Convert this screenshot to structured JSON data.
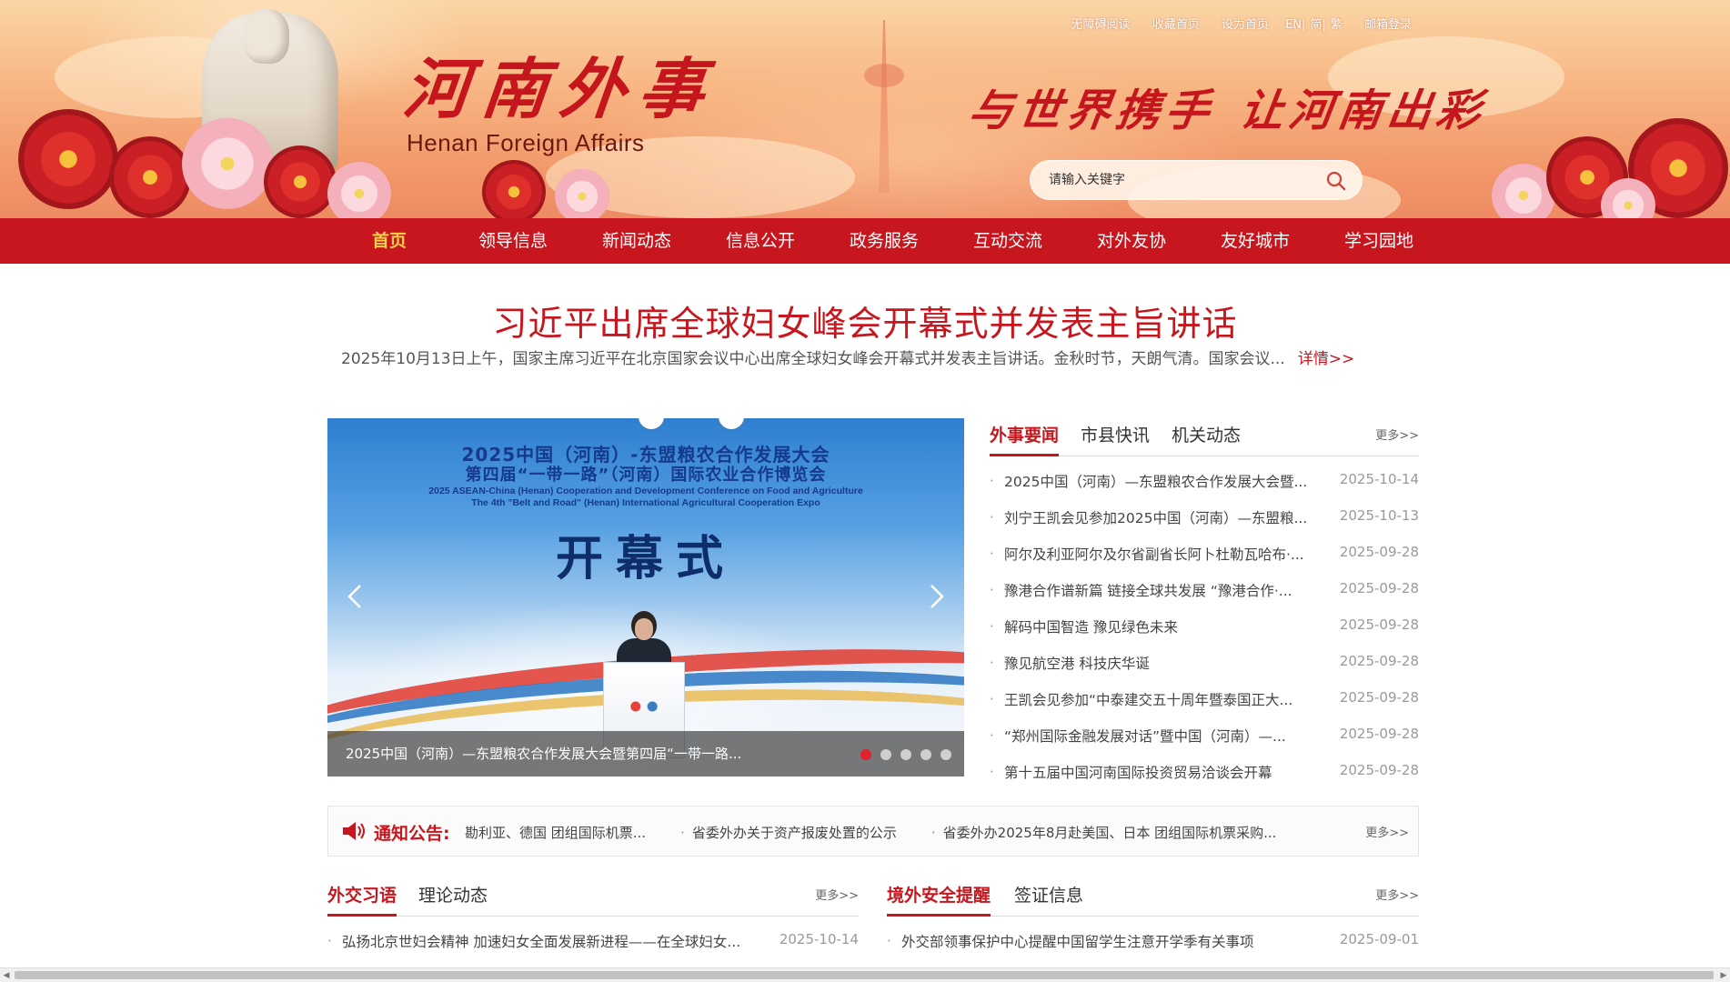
{
  "header": {
    "logo_cn": "河南外事",
    "logo_en": "Henan  Foreign Affairs",
    "slogan_a": "与世界携手",
    "slogan_b": "让河南出彩",
    "toplinks": {
      "accessible": "无障碍阅读",
      "favorite": "收藏首页",
      "set_home": "设为首页",
      "lang_en": "EN",
      "lang_simplified": "简",
      "lang_traditional": "繁",
      "mail_login": "邮箱登录",
      "sep": "|"
    },
    "search": {
      "placeholder": "请输入关键字",
      "icon": "search-icon"
    }
  },
  "nav": {
    "items": [
      {
        "label": "首页",
        "active": true
      },
      {
        "label": "领导信息"
      },
      {
        "label": "新闻动态"
      },
      {
        "label": "信息公开"
      },
      {
        "label": "政务服务"
      },
      {
        "label": "互动交流"
      },
      {
        "label": "对外友协"
      },
      {
        "label": "友好城市"
      },
      {
        "label": "学习园地"
      }
    ]
  },
  "headline": {
    "title": "习近平出席全球妇女峰会开幕式并发表主旨讲话",
    "summary": "2025年10月13日上午，国家主席习近平在北京国家会议中心出席全球妇女峰会开幕式并发表主旨讲话。金秋时节，天朗气清。国家会议...",
    "more": "详情>>"
  },
  "carousel": {
    "slide_title_1": "2025中国（河南）-东盟粮农合作发展大会",
    "slide_title_2": "第四届“一带一路”（河南）国际农业合作博览会",
    "slide_en_1": "2025 ASEAN-China (Henan) Cooperation and Development Conference on Food and Agriculture",
    "slide_en_2": "The 4th \"Belt and Road\" (Henan) International Agricultural Cooperation Expo",
    "slide_big": "开幕式",
    "caption": "2025中国（河南）—东盟粮农合作发展大会暨第四届“一带一路...",
    "dots": 5,
    "active_dot": 1
  },
  "news": {
    "tabs": [
      "外事要闻",
      "市县快讯",
      "机关动态"
    ],
    "more": "更多>>",
    "items": [
      {
        "title": "2025中国（河南）—东盟粮农合作发展大会暨...",
        "date": "2025-10-14"
      },
      {
        "title": "刘宁王凯会见参加2025中国（河南）—东盟粮...",
        "date": "2025-10-13"
      },
      {
        "title": "阿尔及利亚阿尔及尔省副省长阿卜杜勒瓦哈布·...",
        "date": "2025-09-28"
      },
      {
        "title": "豫港合作谱新篇 链接全球共发展 “豫港合作·...",
        "date": "2025-09-28"
      },
      {
        "title": "解码中国智造 豫见绿色未来",
        "date": "2025-09-28"
      },
      {
        "title": "豫见航空港 科技庆华诞",
        "date": "2025-09-28"
      },
      {
        "title": "王凯会见参加“中泰建交五十周年暨泰国正大...",
        "date": "2025-09-28"
      },
      {
        "title": "“郑州国际金融发展对话”暨中国（河南）—...",
        "date": "2025-09-28"
      },
      {
        "title": "第十五届中国河南国际投资贸易洽谈会开幕",
        "date": "2025-09-28"
      }
    ]
  },
  "notice": {
    "label": "通知公告:",
    "items": [
      "勘利亚、德国 团组国际机票...",
      "省委外办关于资产报废处置的公示",
      "省委外办2025年8月赴美国、日本 团组国际机票采购..."
    ],
    "more": "更多>>"
  },
  "block_left": {
    "tabs": [
      "外交习语",
      "理论动态"
    ],
    "more": "更多>>",
    "items": [
      {
        "title": "弘扬北京世妇会精神 加速妇女全面发展新进程——在全球妇女...",
        "date": "2025-10-14"
      }
    ]
  },
  "block_right": {
    "tabs": [
      "境外安全提醒",
      "签证信息"
    ],
    "more": "更多>>",
    "items": [
      {
        "title": "外交部领事保护中心提醒中国留学生注意开学季有关事项",
        "date": "2025-09-01"
      }
    ]
  },
  "colors": {
    "brand_red": "#c7161d",
    "nav_active": "#ffd24a",
    "dot_active": "#e0202a"
  }
}
